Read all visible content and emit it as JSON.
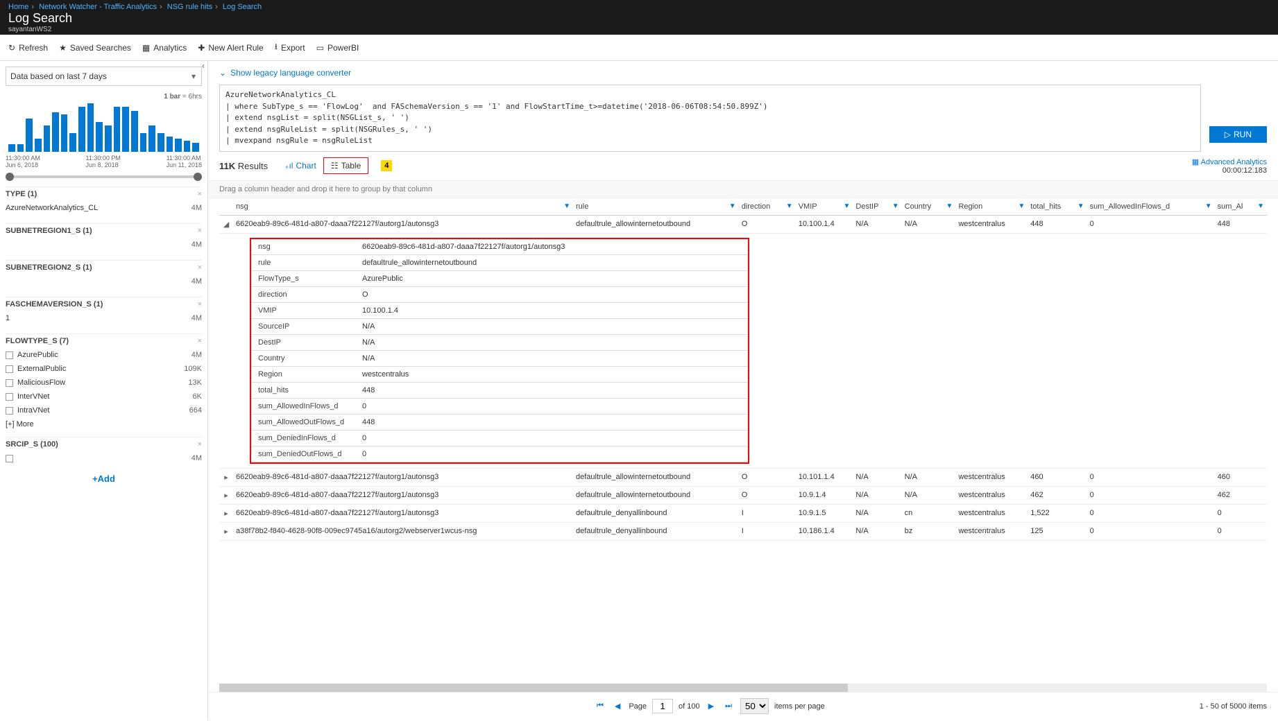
{
  "breadcrumb": [
    "Home",
    "Network Watcher - Traffic Analytics",
    "NSG rule hits",
    "Log Search"
  ],
  "page_title": "Log Search",
  "workspace": "sayantanWS2",
  "toolbar": {
    "refresh": "Refresh",
    "saved": "Saved Searches",
    "analytics": "Analytics",
    "newalert": "New Alert Rule",
    "export": "Export",
    "powerbi": "PowerBI"
  },
  "sidebar": {
    "time_range": "Data based on last 7 days",
    "bar_info_label": "1 bar",
    "bar_info_val": "= 6hrs",
    "xaxis": [
      {
        "t": "11:30:00 AM",
        "d": "Jun 6, 2018"
      },
      {
        "t": "11:30:00 PM",
        "d": "Jun 8, 2018"
      },
      {
        "t": "11:30:00 AM",
        "d": "Jun 11, 2018"
      }
    ],
    "facets": [
      {
        "name": "TYPE",
        "count": "(1)",
        "rows": [
          {
            "label": "AzureNetworkAnalytics_CL",
            "val": "4M"
          }
        ]
      },
      {
        "name": "SUBNETREGION1_S",
        "count": "(1)",
        "rows": [
          {
            "label": "",
            "val": "4M"
          }
        ]
      },
      {
        "name": "SUBNETREGION2_S",
        "count": "(1)",
        "rows": [
          {
            "label": "",
            "val": "4M"
          }
        ]
      },
      {
        "name": "FASCHEMAVERSION_S",
        "count": "(1)",
        "rows": [
          {
            "label": "1",
            "val": "4M"
          }
        ]
      },
      {
        "name": "FLOWTYPE_S",
        "count": "(7)",
        "cb": true,
        "rows": [
          {
            "label": "AzurePublic",
            "val": "4M"
          },
          {
            "label": "ExternalPublic",
            "val": "109K"
          },
          {
            "label": "MaliciousFlow",
            "val": "13K"
          },
          {
            "label": "InterVNet",
            "val": "6K"
          },
          {
            "label": "IntraVNet",
            "val": "664"
          }
        ],
        "more": "[+] More"
      },
      {
        "name": "SRCIP_S",
        "count": "(100)",
        "cb": true,
        "rows": [
          {
            "label": "",
            "val": "4M"
          }
        ]
      }
    ],
    "add": "+Add"
  },
  "legacy_link": "Show legacy language converter",
  "query": "AzureNetworkAnalytics_CL\n| where SubType_s == 'FlowLog'  and FASchemaVersion_s == '1' and FlowStartTime_t>=datetime('2018-06-06T08:54:50.899Z')\n| extend nsgList = split(NSGList_s, ' ')\n| extend nsgRuleList = split(NSGRules_s, ' ')\n| mvexpand nsgRule = nsgRuleList",
  "run_label": "RUN",
  "results_count": "11K",
  "results_label": "Results",
  "view_chart": "Chart",
  "view_table": "Table",
  "callout": "4",
  "adv_link": "Advanced Analytics",
  "timing": "00:00:12.183",
  "group_hint": "Drag a column header and drop it here to group by that column",
  "columns": [
    "nsg",
    "rule",
    "direction",
    "VMIP",
    "DestIP",
    "Country",
    "Region",
    "total_hits",
    "sum_AllowedInFlows_d",
    "sum_Al"
  ],
  "rows": [
    {
      "exp": true,
      "nsg": "6620eab9-89c6-481d-a807-daaa7f22127f/autorg1/autonsg3",
      "rule": "defaultrule_allowinternetoutbound",
      "direction": "O",
      "VMIP": "10.100.1.4",
      "DestIP": "N/A",
      "Country": "N/A",
      "Region": "westcentralus",
      "total_hits": "448",
      "sum_AllowedInFlows_d": "0",
      "sum_Al": "448"
    },
    {
      "exp": false,
      "nsg": "6620eab9-89c6-481d-a807-daaa7f22127f/autorg1/autonsg3",
      "rule": "defaultrule_allowinternetoutbound",
      "direction": "O",
      "VMIP": "10.101.1.4",
      "DestIP": "N/A",
      "Country": "N/A",
      "Region": "westcentralus",
      "total_hits": "460",
      "sum_AllowedInFlows_d": "0",
      "sum_Al": "460"
    },
    {
      "exp": false,
      "nsg": "6620eab9-89c6-481d-a807-daaa7f22127f/autorg1/autonsg3",
      "rule": "defaultrule_allowinternetoutbound",
      "direction": "O",
      "VMIP": "10.9.1.4",
      "DestIP": "N/A",
      "Country": "N/A",
      "Region": "westcentralus",
      "total_hits": "462",
      "sum_AllowedInFlows_d": "0",
      "sum_Al": "462"
    },
    {
      "exp": false,
      "nsg": "6620eab9-89c6-481d-a807-daaa7f22127f/autorg1/autonsg3",
      "rule": "defaultrule_denyallinbound",
      "direction": "I",
      "VMIP": "10.9.1.5",
      "DestIP": "N/A",
      "Country": "cn",
      "Region": "westcentralus",
      "total_hits": "1,522",
      "sum_AllowedInFlows_d": "0",
      "sum_Al": "0"
    },
    {
      "exp": false,
      "nsg": "a38f78b2-f840-4628-90f8-009ec9745a16/autorg2/webserver1wcus-nsg",
      "rule": "defaultrule_denyallinbound",
      "direction": "I",
      "VMIP": "10.186.1.4",
      "DestIP": "N/A",
      "Country": "bz",
      "Region": "westcentralus",
      "total_hits": "125",
      "sum_AllowedInFlows_d": "0",
      "sum_Al": "0"
    }
  ],
  "detail": [
    [
      "nsg",
      "6620eab9-89c6-481d-a807-daaa7f22127f/autorg1/autonsg3"
    ],
    [
      "rule",
      "defaultrule_allowinternetoutbound"
    ],
    [
      "FlowType_s",
      "AzurePublic"
    ],
    [
      "direction",
      "O"
    ],
    [
      "VMIP",
      "10.100.1.4"
    ],
    [
      "SourceIP",
      "N/A"
    ],
    [
      "DestIP",
      "N/A"
    ],
    [
      "Country",
      "N/A"
    ],
    [
      "Region",
      "westcentralus"
    ],
    [
      "total_hits",
      "448"
    ],
    [
      "sum_AllowedInFlows_d",
      "0"
    ],
    [
      "sum_AllowedOutFlows_d",
      "448"
    ],
    [
      "sum_DeniedInFlows_d",
      "0"
    ],
    [
      "sum_DeniedOutFlows_d",
      "0"
    ]
  ],
  "pager": {
    "page_label": "Page",
    "page": "1",
    "of": "of 100",
    "perpage": "50",
    "ipp": "items per page",
    "summary": "1 - 50 of 5000 items"
  },
  "chart_data": {
    "type": "bar",
    "title": "",
    "values": [
      4,
      4,
      18,
      7,
      14,
      21,
      20,
      10,
      24,
      26,
      16,
      14,
      24,
      24,
      22,
      10,
      14,
      10,
      8,
      7,
      6,
      5
    ],
    "xlabel": "",
    "ylabel": "",
    "ylim": [
      0,
      30
    ]
  }
}
